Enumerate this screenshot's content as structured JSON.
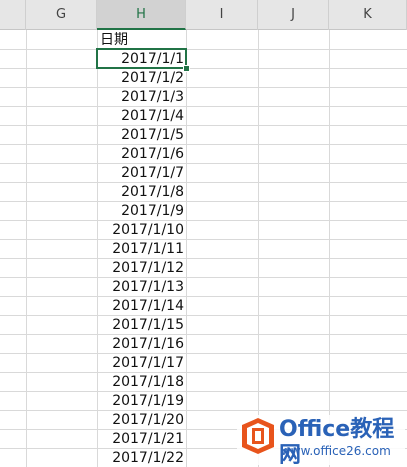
{
  "columns": [
    "G",
    "H",
    "I",
    "J",
    "K"
  ],
  "header_cell": "日期",
  "dates": [
    "2017/1/1",
    "2017/1/2",
    "2017/1/3",
    "2017/1/4",
    "2017/1/5",
    "2017/1/6",
    "2017/1/7",
    "2017/1/8",
    "2017/1/9",
    "2017/1/10",
    "2017/1/11",
    "2017/1/12",
    "2017/1/13",
    "2017/1/14",
    "2017/1/15",
    "2017/1/16",
    "2017/1/17",
    "2017/1/18",
    "2017/1/19",
    "2017/1/20",
    "2017/1/21",
    "2017/1/22"
  ],
  "selected_column": "H",
  "active_cell_value": "2017/1/1",
  "colors": {
    "accent": "#217346",
    "watermark": "#2a62b7",
    "logo_orange": "#e8541c"
  },
  "watermark": {
    "title": "Office教程网",
    "url": "www.office26.com"
  }
}
